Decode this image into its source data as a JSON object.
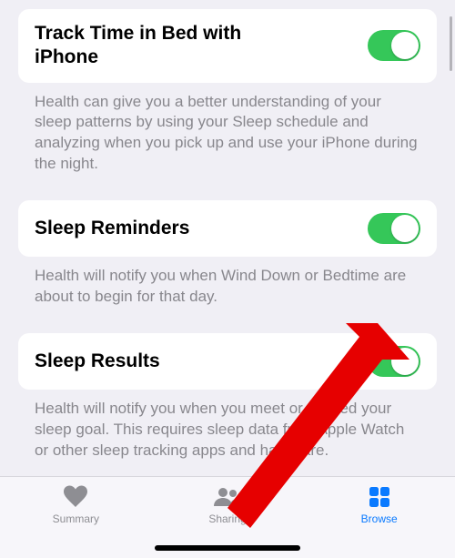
{
  "colors": {
    "toggle_on": "#35c759",
    "accent": "#0a7aff"
  },
  "rows": {
    "track": {
      "title": "Track Time in Bed with iPhone",
      "desc": "Health can give you a better understanding of your sleep patterns by using your Sleep schedule and analyzing when you pick up and use your iPhone during the night.",
      "on": true
    },
    "reminders": {
      "title": "Sleep Reminders",
      "desc": "Health will notify you when Wind Down or Bedtime are about to begin for that day.",
      "on": true
    },
    "results": {
      "title": "Sleep Results",
      "desc": "Health will notify you when you meet or exceed your sleep goal. This requires sleep data from Apple Watch or other sleep tracking apps and hardware.",
      "on": true
    }
  },
  "tabs": {
    "summary": "Summary",
    "sharing": "Sharing",
    "browse": "Browse"
  }
}
